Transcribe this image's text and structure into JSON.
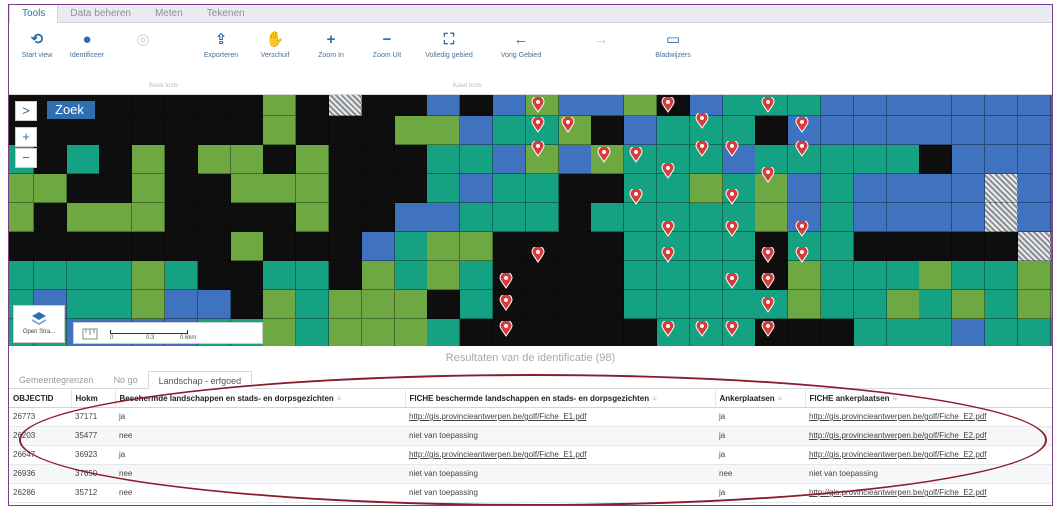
{
  "ribbon": {
    "tabs": [
      {
        "label": "Tools",
        "active": true
      },
      {
        "label": "Data beheren",
        "active": false
      },
      {
        "label": "Meten",
        "active": false
      },
      {
        "label": "Tekenen",
        "active": false
      }
    ]
  },
  "toolbar": {
    "tools": [
      {
        "label": "Start view",
        "icon": "refresh-icon",
        "glyph": "⟲",
        "enabled": true
      },
      {
        "label": "Identificeer",
        "icon": "identify-icon",
        "glyph": "●",
        "enabled": true
      },
      {
        "label": "",
        "icon": "select-icon",
        "glyph": "◎",
        "enabled": false
      },
      {
        "label": "Exporteren",
        "icon": "export-icon",
        "glyph": "⇪",
        "enabled": true
      },
      {
        "label": "Verschuif",
        "icon": "pan-hand-icon",
        "glyph": "✋",
        "enabled": true
      },
      {
        "label": "Zoom In",
        "icon": "zoom-in-icon",
        "glyph": "+",
        "enabled": true
      },
      {
        "label": "Zoom Uit",
        "icon": "zoom-out-icon",
        "glyph": "−",
        "enabled": true
      },
      {
        "label": "Volledig gebied",
        "icon": "full-extent-icon",
        "glyph": "⛶",
        "enabled": true
      },
      {
        "label": "Vorig Gebied",
        "icon": "previous-extent-icon",
        "glyph": "←",
        "enabled": true
      },
      {
        "label": "",
        "icon": "next-extent-icon",
        "glyph": "→",
        "enabled": false
      },
      {
        "label": "Bladwijzers",
        "icon": "bookmark-icon",
        "glyph": "▭",
        "enabled": true
      }
    ],
    "group_labels": [
      "Basis tools",
      "Kaart tools"
    ]
  },
  "map": {
    "search_label": "Zoek",
    "expand_glyph": ">",
    "zoom_in_glyph": "+",
    "zoom_out_glyph": "−",
    "basemap_label": "Open Stra...",
    "scale_labels": [
      "0",
      "0.3",
      "0.6km"
    ],
    "colors": {
      "green": "#6ea843",
      "teal": "#15a283",
      "blue": "#3f72bf",
      "black": "#0e0e0e",
      "pin": "#d93a3a"
    }
  },
  "results": {
    "title": "Resultaten van de identificatie (98)",
    "tabs": [
      {
        "label": "Gemeentegrenzen",
        "active": false
      },
      {
        "label": "No go",
        "active": false
      },
      {
        "label": "Landschap - erfgoed",
        "active": true
      }
    ],
    "columns": [
      "OBJECTID",
      "Hokm",
      "Beschermde landschappen en stads- en dorpsgezichten",
      "FICHE beschermde landschappen en stads- en dorpsgezichten",
      "Ankerplaatsen",
      "FICHE ankerplaatsen"
    ],
    "rows": [
      [
        "26773",
        "37171",
        "ja",
        "http://gis.provincieantwerpen.be/golf/Fiche_E1.pdf",
        "ja",
        "http://gis.provincieantwerpen.be/golf/Fiche_E2.pdf"
      ],
      [
        "26203",
        "35477",
        "nee",
        "niet van toepassing",
        "ja",
        "http://gis.provincieantwerpen.be/golf/Fiche_E2.pdf"
      ],
      [
        "26647",
        "36923",
        "ja",
        "http://gis.provincieantwerpen.be/golf/Fiche_E1.pdf",
        "ja",
        "http://gis.provincieantwerpen.be/golf/Fiche_E2.pdf"
      ],
      [
        "26936",
        "37650",
        "nee",
        "niet van toepassing",
        "nee",
        "niet van toepassing"
      ],
      [
        "26286",
        "35712",
        "nee",
        "niet van toepassing",
        "ja",
        "http://gis.provincieantwerpen.be/golf/Fiche_E2.pdf"
      ]
    ]
  }
}
